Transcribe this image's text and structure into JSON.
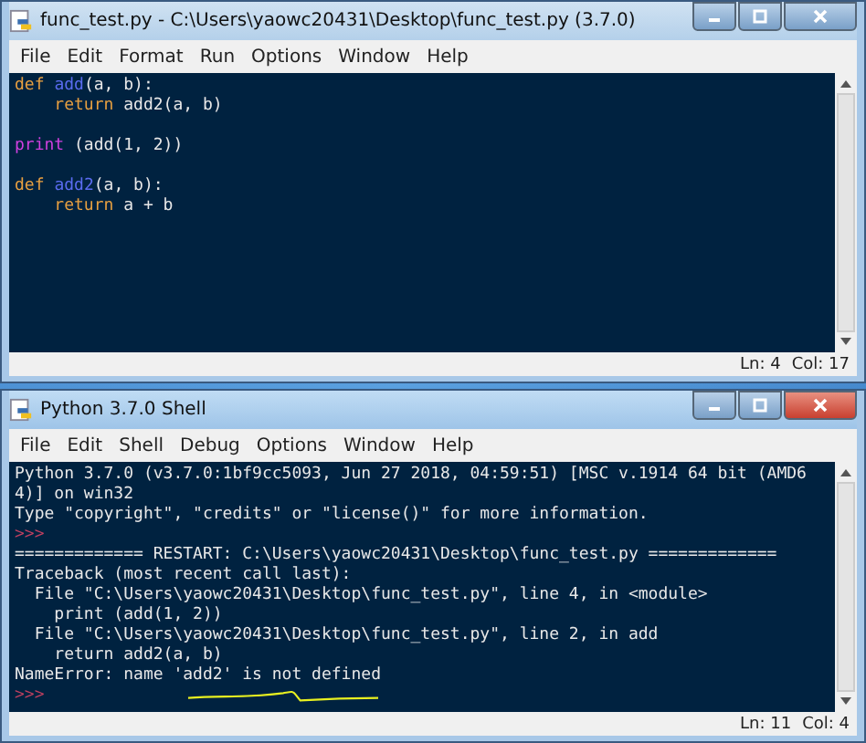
{
  "windows": [
    {
      "kind": "editor",
      "active": false,
      "title": "func_test.py - C:\\Users\\yaowc20431\\Desktop\\func_test.py (3.7.0)",
      "menu": [
        "File",
        "Edit",
        "Format",
        "Run",
        "Options",
        "Window",
        "Help"
      ],
      "lines": [
        {
          "segments": [
            {
              "text": "def ",
              "kind": "keyword"
            },
            {
              "text": "add",
              "kind": "definition"
            },
            {
              "text": "(a, b):",
              "kind": "plain"
            }
          ]
        },
        {
          "segments": [
            {
              "text": "    return ",
              "kind": "keyword"
            },
            {
              "text": "add2(a, b)",
              "kind": "plain"
            }
          ]
        },
        {
          "blank_before": true,
          "segments": [
            {
              "text": "print",
              "kind": "builtin"
            },
            {
              "text": " (add(1, 2))",
              "kind": "plain"
            }
          ]
        },
        {
          "blank_before": true,
          "segments": [
            {
              "text": "def ",
              "kind": "keyword"
            },
            {
              "text": "add2",
              "kind": "definition"
            },
            {
              "text": "(a, b):",
              "kind": "plain"
            }
          ]
        },
        {
          "segments": [
            {
              "text": "    return ",
              "kind": "keyword"
            },
            {
              "text": "a + b",
              "kind": "plain"
            }
          ]
        }
      ],
      "status": {
        "line": "Ln: 4",
        "column": "Col: 17"
      }
    },
    {
      "kind": "shell",
      "active": true,
      "title": "Python 3.7.0 Shell",
      "menu": [
        "File",
        "Edit",
        "Shell",
        "Debug",
        "Options",
        "Window",
        "Help"
      ],
      "lines": [
        {
          "segments": [
            {
              "text": "Python 3.7.0 (v3.7.0:1bf9cc5093, Jun 27 2018, 04:59:51) [MSC v.1914 64 bit (AMD6",
              "kind": "plain"
            }
          ]
        },
        {
          "segments": [
            {
              "text": "4)] on win32",
              "kind": "plain"
            }
          ]
        },
        {
          "segments": [
            {
              "text": "Type \"copyright\", \"credits\" or \"license()\" for more information.",
              "kind": "plain"
            }
          ]
        },
        {
          "segments": [
            {
              "text": ">>>",
              "kind": "prompt"
            }
          ]
        },
        {
          "segments": [
            {
              "text": "============= RESTART: C:\\Users\\yaowc20431\\Desktop\\func_test.py =============",
              "kind": "plain"
            }
          ]
        },
        {
          "segments": [
            {
              "text": "Traceback (most recent call last):",
              "kind": "plain"
            }
          ]
        },
        {
          "segments": [
            {
              "text": "  File \"C:\\Users\\yaowc20431\\Desktop\\func_test.py\", line 4, in <module>",
              "kind": "plain"
            }
          ]
        },
        {
          "segments": [
            {
              "text": "    print (add(1, 2))",
              "kind": "plain"
            }
          ]
        },
        {
          "segments": [
            {
              "text": "  File \"C:\\Users\\yaowc20431\\Desktop\\func_test.py\", line 2, in add",
              "kind": "plain"
            }
          ]
        },
        {
          "segments": [
            {
              "text": "    return add2(a, b)",
              "kind": "plain"
            }
          ]
        },
        {
          "segments": [
            {
              "text": "NameError: name 'add2' is not defined",
              "kind": "plain"
            }
          ]
        },
        {
          "segments": [
            {
              "text": ">>>",
              "kind": "prompt"
            }
          ]
        }
      ],
      "status": {
        "line": "Ln: 11",
        "column": "Col: 4"
      }
    }
  ]
}
